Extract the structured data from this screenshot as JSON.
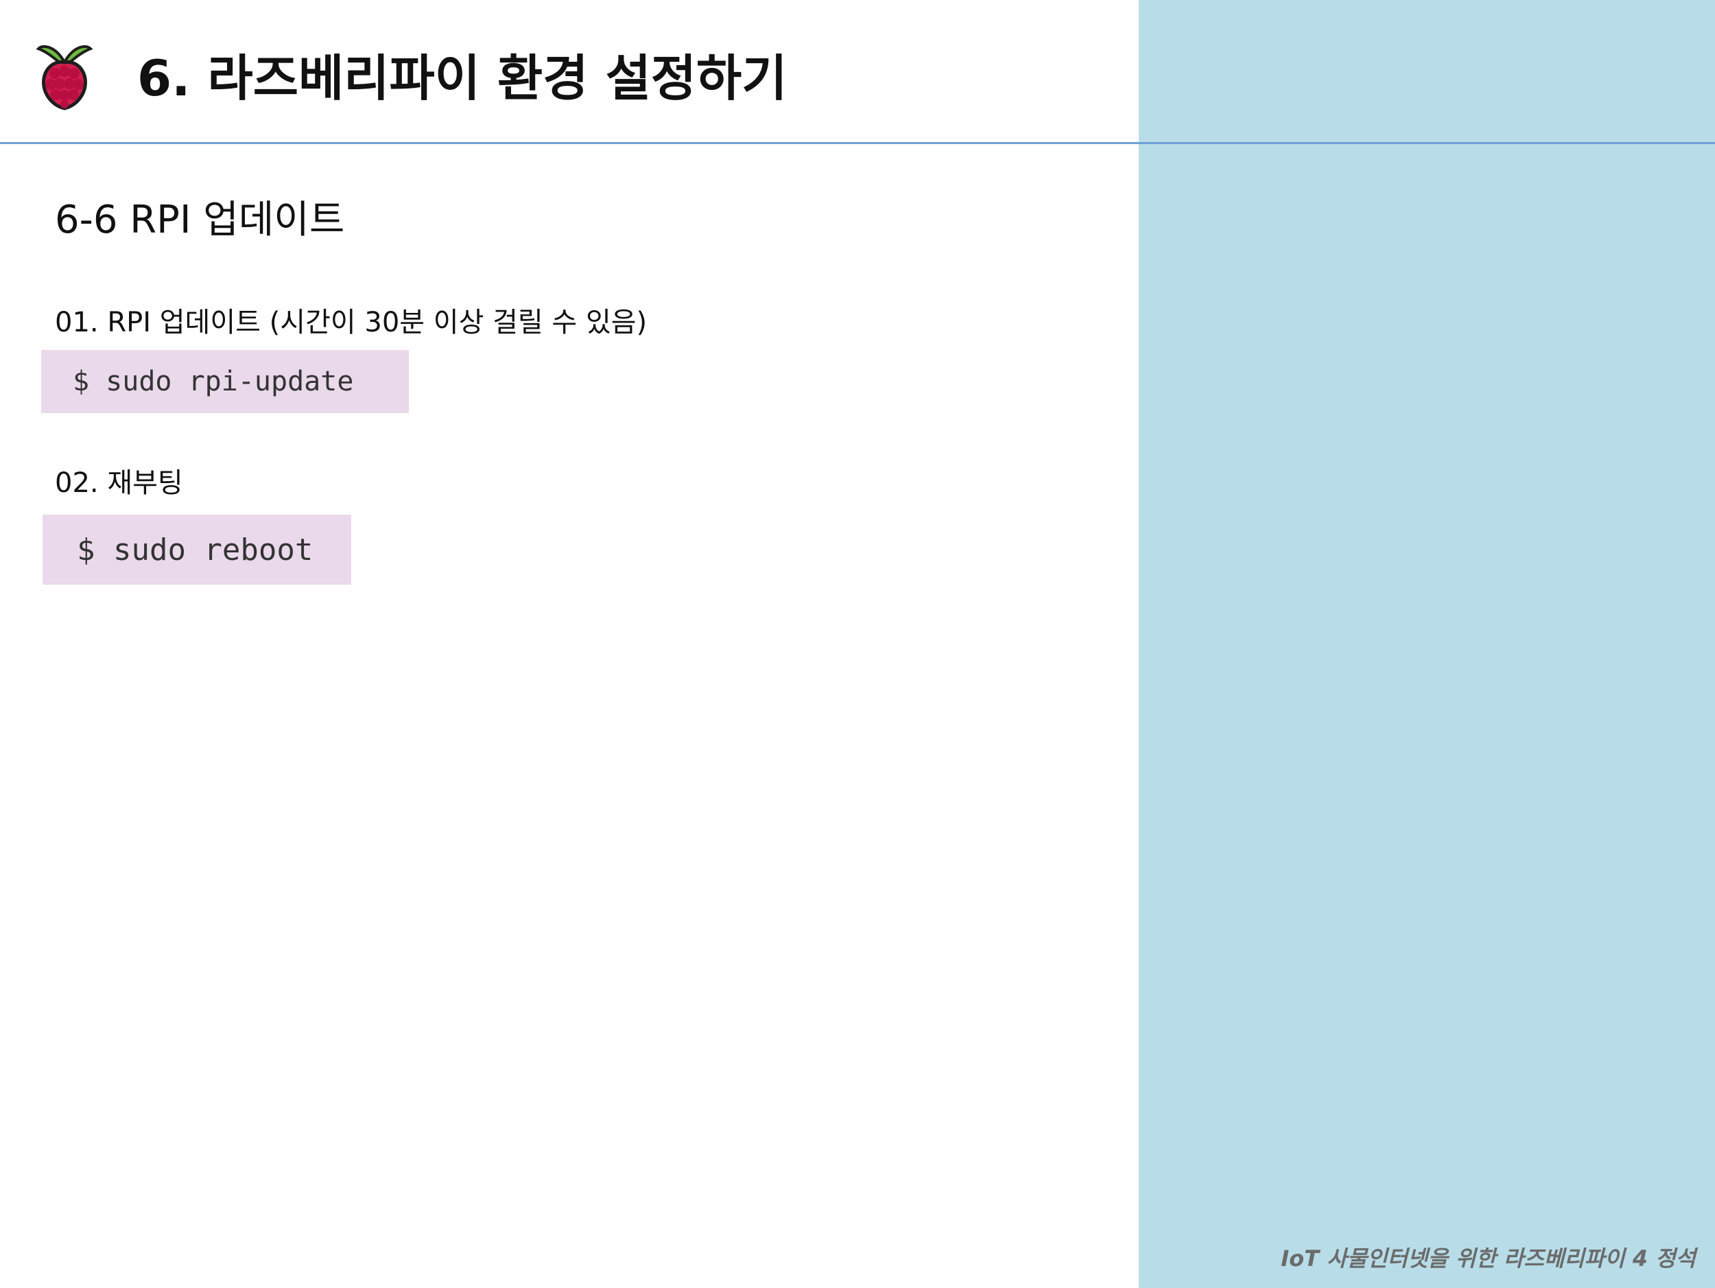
{
  "slide": {
    "title": "6. 라즈베리파이 환경 설정하기",
    "logo_icon": "raspberry-pi-logo-icon",
    "section_title": "6-6 RPI 업데이트",
    "steps": [
      {
        "label": "01. RPI 업데이트 (시간이 30분 이상 걸릴 수 있음)",
        "command": "$ sudo rpi-update"
      },
      {
        "label": "02. 재부팅",
        "command": "$ sudo reboot"
      }
    ],
    "footer": "IoT 사물인터넷을 위한 라즈베리파이 4 정석"
  },
  "colors": {
    "right_panel": "#b8dde8",
    "header_rule": "#6f9fd8",
    "code_background": "#ead9ea",
    "footer_text": "#6b6b6b"
  }
}
